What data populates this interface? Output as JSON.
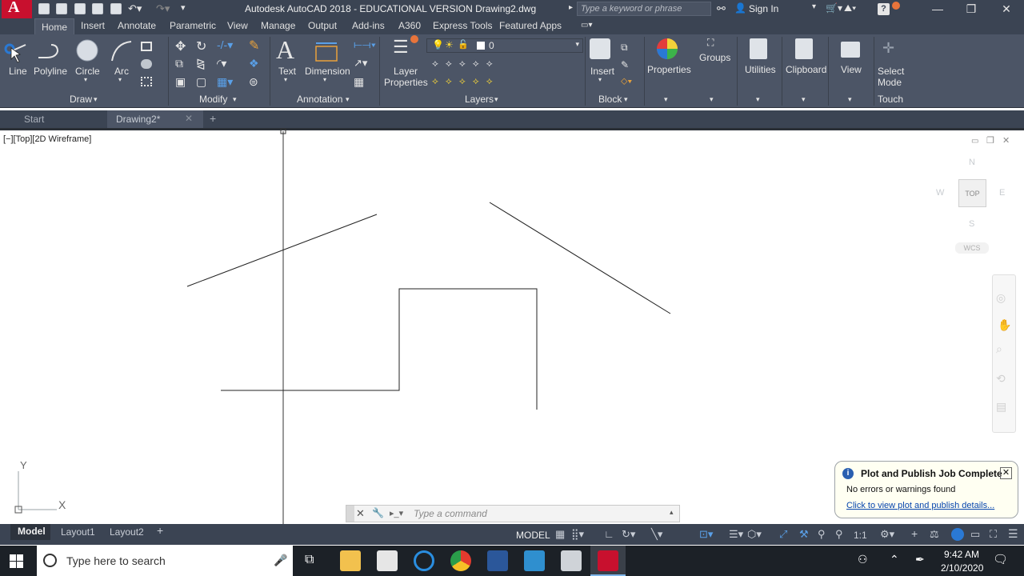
{
  "titlebar": {
    "title": "Autodesk AutoCAD 2018 - EDUCATIONAL VERSION    Drawing2.dwg",
    "search_placeholder": "Type a keyword or phrase",
    "sign_in": "Sign In",
    "app_letter": "A"
  },
  "menu_tabs": [
    "Home",
    "Insert",
    "Annotate",
    "Parametric",
    "View",
    "Manage",
    "Output",
    "Add-ins",
    "A360",
    "Express Tools",
    "Featured Apps"
  ],
  "ribbon": {
    "draw": {
      "line": "Line",
      "polyline": "Polyline",
      "circle": "Circle",
      "arc": "Arc",
      "panel": "Draw"
    },
    "modify": {
      "panel": "Modify"
    },
    "annotation": {
      "text": "Text",
      "dimension": "Dimension",
      "panel": "Annotation"
    },
    "layers": {
      "layer_properties_1": "Layer",
      "layer_properties_2": "Properties",
      "layer_value": "0",
      "panel": "Layers"
    },
    "block": {
      "insert": "Insert",
      "panel": "Block"
    },
    "properties": "Properties",
    "groups": "Groups",
    "utilities": "Utilities",
    "clipboard": "Clipboard",
    "view": "View",
    "select_mode_1": "Select",
    "select_mode_2": "Mode",
    "touch": "Touch"
  },
  "doc_tabs": {
    "start": "Start",
    "drawing": "Drawing2*",
    "add": "+"
  },
  "viewport_label": "[−][Top][2D Wireframe]",
  "viewcube": {
    "top": "TOP",
    "n": "N",
    "s": "S",
    "e": "E",
    "w": "W",
    "wcs": "WCS"
  },
  "ucs": {
    "x": "X",
    "y": "Y"
  },
  "command": {
    "placeholder": "Type  a  command"
  },
  "layout_tabs": [
    "Model",
    "Layout1",
    "Layout2",
    "+"
  ],
  "status": {
    "model": "MODEL",
    "scale": "1:1"
  },
  "notification": {
    "title": "Plot and Publish Job Complete",
    "message": "No errors or warnings found",
    "link": "Click to view plot and publish details..."
  },
  "taskbar": {
    "search": "Type here to search",
    "time": "9:42 AM",
    "date": "2/10/2020"
  },
  "colors": {
    "accent_blue": "#0078d7",
    "autocad_red": "#c8102e",
    "ribbon_bg": "#4c5566",
    "title_bg": "#3b4453"
  }
}
